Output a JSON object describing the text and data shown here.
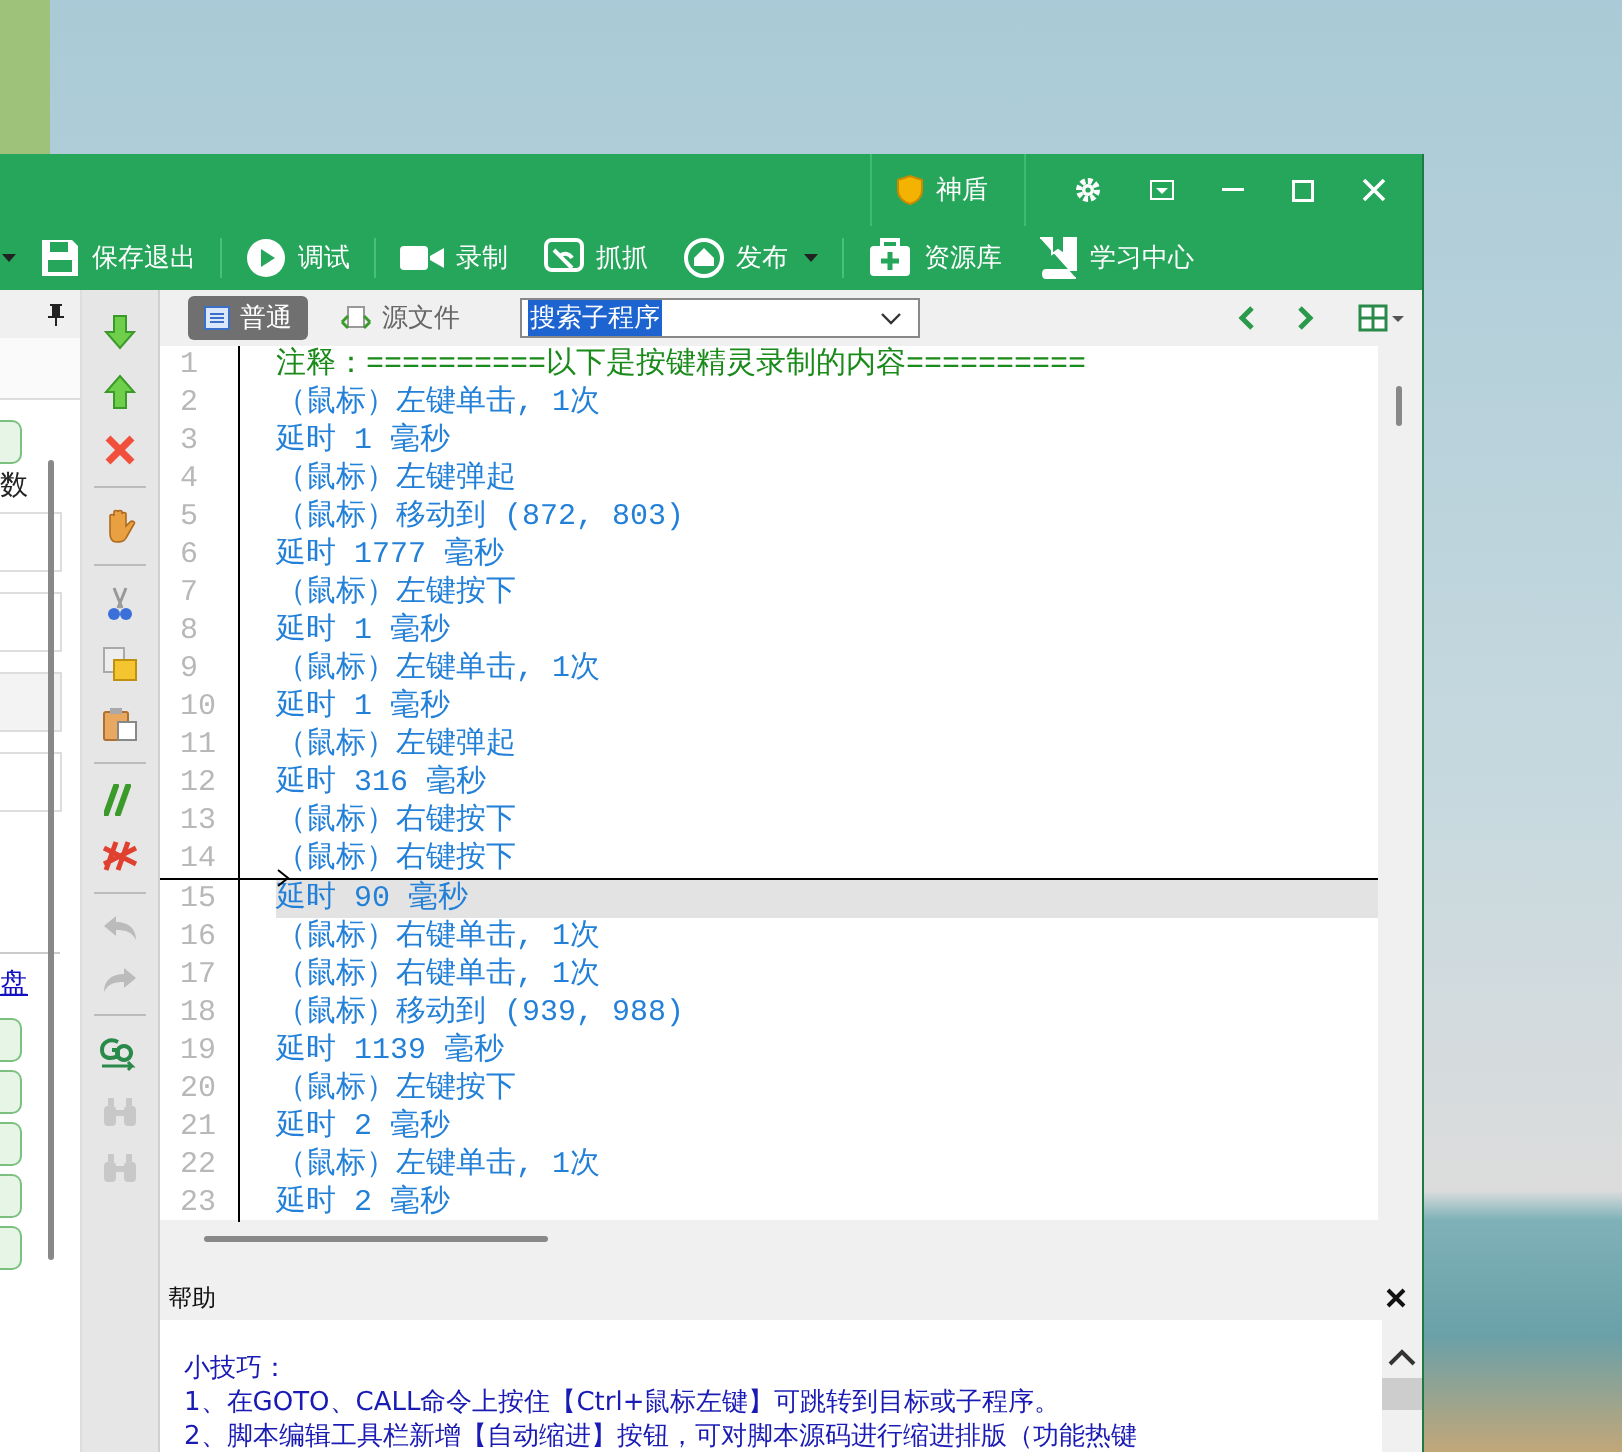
{
  "window": {
    "shield_label": "神盾"
  },
  "toolbar": [
    {
      "label": "保存退出",
      "kind": "save",
      "dropdown": false
    },
    {
      "label": "调试",
      "kind": "debug",
      "dropdown": false
    },
    {
      "label": "录制",
      "kind": "record",
      "dropdown": false
    },
    {
      "label": "抓抓",
      "kind": "capture",
      "dropdown": false
    },
    {
      "label": "发布",
      "kind": "publish",
      "dropdown": true
    },
    {
      "label": "资源库",
      "kind": "resources",
      "dropdown": false
    },
    {
      "label": "学习中心",
      "kind": "learn",
      "dropdown": false
    }
  ],
  "left_panel": {
    "fragment": "数",
    "link": "盘"
  },
  "side_tools": [
    {
      "kind": "move-down",
      "disabled": false
    },
    {
      "kind": "move-up",
      "disabled": false
    },
    {
      "kind": "delete",
      "disabled": false
    },
    {
      "kind": "separator"
    },
    {
      "kind": "hand",
      "disabled": false
    },
    {
      "kind": "separator"
    },
    {
      "kind": "cut",
      "disabled": false
    },
    {
      "kind": "copy",
      "disabled": false
    },
    {
      "kind": "paste",
      "disabled": false
    },
    {
      "kind": "separator"
    },
    {
      "kind": "comment",
      "disabled": false
    },
    {
      "kind": "uncomment",
      "disabled": false
    },
    {
      "kind": "separator"
    },
    {
      "kind": "undo",
      "disabled": true
    },
    {
      "kind": "redo",
      "disabled": true
    },
    {
      "kind": "separator"
    },
    {
      "kind": "goto",
      "disabled": false
    },
    {
      "kind": "find",
      "disabled": true
    },
    {
      "kind": "find",
      "disabled": true
    }
  ],
  "editor": {
    "tabs": [
      {
        "label": "普通",
        "selected": true
      },
      {
        "label": "源文件",
        "selected": false
      }
    ],
    "search": {
      "value": "搜索子程序"
    },
    "lines": [
      {
        "number": "1",
        "text": "注释：==========以下是按键精灵录制的内容==========",
        "kind": "comment",
        "selected": false,
        "insert_before": false
      },
      {
        "number": "2",
        "text": "（鼠标）左键单击, 1次",
        "kind": "code",
        "selected": false,
        "insert_before": false
      },
      {
        "number": "3",
        "text": "延时 1 毫秒",
        "kind": "code",
        "selected": false,
        "insert_before": false
      },
      {
        "number": "4",
        "text": "（鼠标）左键弹起",
        "kind": "code",
        "selected": false,
        "insert_before": false
      },
      {
        "number": "5",
        "text": "（鼠标）移动到 (872, 803)",
        "kind": "code",
        "selected": false,
        "insert_before": false
      },
      {
        "number": "6",
        "text": "延时 1777 毫秒",
        "kind": "code",
        "selected": false,
        "insert_before": false
      },
      {
        "number": "7",
        "text": "（鼠标）左键按下",
        "kind": "code",
        "selected": false,
        "insert_before": false
      },
      {
        "number": "8",
        "text": "延时 1 毫秒",
        "kind": "code",
        "selected": false,
        "insert_before": false
      },
      {
        "number": "9",
        "text": "（鼠标）左键单击, 1次",
        "kind": "code",
        "selected": false,
        "insert_before": false
      },
      {
        "number": "10",
        "text": "延时 1 毫秒",
        "kind": "code",
        "selected": false,
        "insert_before": false
      },
      {
        "number": "11",
        "text": "（鼠标）左键弹起",
        "kind": "code",
        "selected": false,
        "insert_before": false
      },
      {
        "number": "12",
        "text": "延时 316 毫秒",
        "kind": "code",
        "selected": false,
        "insert_before": false
      },
      {
        "number": "13",
        "text": "（鼠标）右键按下",
        "kind": "code",
        "selected": false,
        "insert_before": false
      },
      {
        "number": "14",
        "text": "（鼠标）右键按下",
        "kind": "code",
        "selected": false,
        "insert_before": false
      },
      {
        "number": "15",
        "text": "延时 90 毫秒",
        "kind": "code",
        "selected": true,
        "insert_before": true
      },
      {
        "number": "16",
        "text": "（鼠标）右键单击, 1次",
        "kind": "code",
        "selected": false,
        "insert_before": false
      },
      {
        "number": "17",
        "text": "（鼠标）右键单击, 1次",
        "kind": "code",
        "selected": false,
        "insert_before": false
      },
      {
        "number": "18",
        "text": "（鼠标）移动到 (939, 988)",
        "kind": "code",
        "selected": false,
        "insert_before": false
      },
      {
        "number": "19",
        "text": "延时 1139 毫秒",
        "kind": "code",
        "selected": false,
        "insert_before": false
      },
      {
        "number": "20",
        "text": "（鼠标）左键按下",
        "kind": "code",
        "selected": false,
        "insert_before": false
      },
      {
        "number": "21",
        "text": "延时 2 毫秒",
        "kind": "code",
        "selected": false,
        "insert_before": false
      },
      {
        "number": "22",
        "text": "（鼠标）左键单击, 1次",
        "kind": "code",
        "selected": false,
        "insert_before": false
      },
      {
        "number": "23",
        "text": "延时 2 毫秒",
        "kind": "code",
        "selected": false,
        "insert_before": false
      }
    ]
  },
  "help": {
    "title": "帮助",
    "lines": [
      "小技巧：",
      "1、在GOTO、CALL命令上按住【Ctrl+鼠标左键】可跳转到目标或子程序。",
      "2、脚本编辑工具栏新增【自动缩进】按钮，可对脚本源码进行缩进排版（功能热键"
    ]
  }
}
